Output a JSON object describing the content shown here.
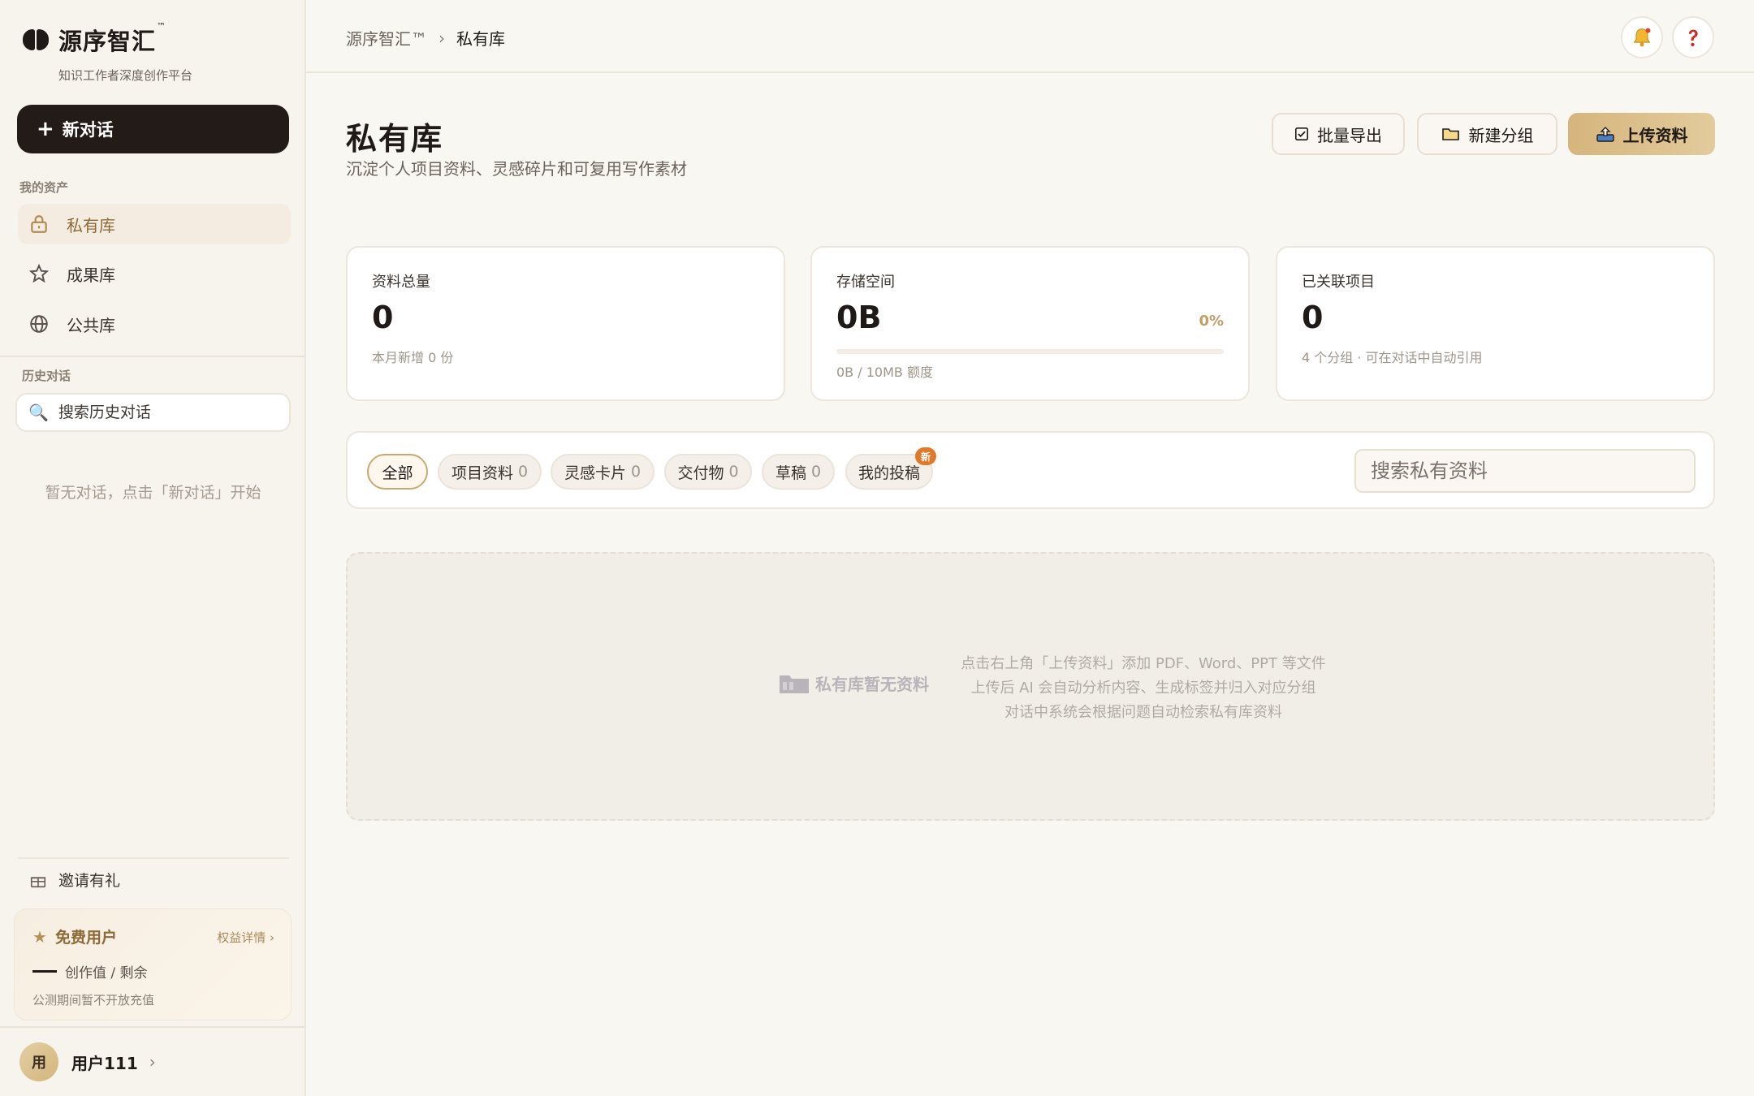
{
  "brand": {
    "name": "源序智汇",
    "tm": "™",
    "tagline": "知识工作者深度创作平台"
  },
  "sidebar": {
    "new_chat_label": "新对话",
    "assets_label": "我的资产",
    "nav": [
      {
        "label": "私有库",
        "icon": "lock-icon",
        "active": true
      },
      {
        "label": "成果库",
        "icon": "star-icon",
        "active": false
      },
      {
        "label": "公共库",
        "icon": "globe-icon",
        "active": false
      }
    ],
    "history_label": "历史对话",
    "history_search_placeholder": "搜索历史对话",
    "history_empty": "暂无对话，点击「新对话」开始",
    "invite_label": "邀请有礼",
    "member": {
      "title": "免费用户",
      "link": "权益详情 ›",
      "usage": "创作值 / 剩余",
      "note": "公测期间暂不开放充值"
    },
    "user": {
      "avatar": "用",
      "name": "用户111"
    }
  },
  "topbar": {
    "breadcrumb": [
      "源序智汇™",
      "私有库"
    ],
    "breadcrumb_sep": "›"
  },
  "page": {
    "title": "私有库",
    "subtitle": "沉淀个人项目资料、灵感碎片和可复用写作素材",
    "buttons": {
      "export": "批量导出",
      "new_group": "新建分组",
      "upload": "上传资料"
    }
  },
  "stats": [
    {
      "label": "资料总量",
      "value": "0",
      "sub": "本月新增 0 份"
    },
    {
      "label": "存储空间",
      "value": "0B",
      "percent": "0%",
      "usage_fraction": 0,
      "sub": "0B / 10MB 额度"
    },
    {
      "label": "已关联项目",
      "value": "0",
      "sub": "4 个分组 · 可在对话中自动引用"
    }
  ],
  "filters": {
    "chips": [
      {
        "label": "全部",
        "count": ""
      },
      {
        "label": "项目资料",
        "count": "0"
      },
      {
        "label": "灵感卡片",
        "count": "0"
      },
      {
        "label": "交付物",
        "count": "0"
      },
      {
        "label": "草稿",
        "count": "0"
      },
      {
        "label": "我的投稿",
        "count": "",
        "badge": "新"
      }
    ],
    "search_placeholder": "搜索私有资料"
  },
  "empty": {
    "title": "私有库暂无资料",
    "lines": [
      "点击右上角「上传资料」添加 PDF、Word、PPT 等文件",
      "上传后 AI 会自动分析内容、生成标签并归入对应分组",
      "对话中系统会根据问题自动检索私有库资料"
    ]
  },
  "colors": {
    "accent": "#c19f66",
    "primary_dark": "#221b18",
    "badge": "#e07a2a"
  }
}
